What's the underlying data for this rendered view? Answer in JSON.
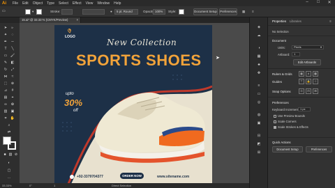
{
  "menubar": {
    "items": [
      "File",
      "Edit",
      "Object",
      "Type",
      "Select",
      "Effect",
      "View",
      "Window",
      "Help"
    ],
    "window_controls": [
      "–",
      "□",
      "✕"
    ]
  },
  "control_bar": {
    "stroke_label": "Stroke:",
    "brush_value": "5 pt. Round",
    "opacity_label": "Opacity:",
    "opacity_value": "100%",
    "style_label": "Style:",
    "doc_setup": "Document Setup",
    "preferences": "Preferences"
  },
  "document_tab": {
    "title": "15.ai* @ 33.33 % (CMYK/Preview)",
    "close": "×"
  },
  "artwork": {
    "logo_text": "LOGO",
    "script_heading": "New Collection",
    "headline": "SPORTS SHOES",
    "offer_small": "upto",
    "offer_percent": "30%",
    "offer_off": "off",
    "phone": "+92-3379704377",
    "order_button": "ORDER NOW",
    "website": "www.sitename.com",
    "colors": {
      "navy": "#1d3047",
      "orange": "#f2a33a",
      "cream": "#e8e1cf",
      "red": "#c0392b"
    }
  },
  "statusbar": {
    "zoom": "33.33%",
    "rotation": "0°",
    "page": "1",
    "tool_name": "Direct Selection"
  },
  "properties": {
    "tab_properties": "Properties",
    "tab_libraries": "Libraries",
    "no_selection": "No Selection",
    "document_heading": "Document",
    "units_label": "Units:",
    "units_value": "Pixels",
    "artboard_label": "Artboard:",
    "artboard_value": "1",
    "edit_artboards": "Edit Artboards",
    "rulers_grids": "Rulers & Grids",
    "guides": "Guides",
    "snap_options": "Snap Options",
    "preferences_heading": "Preferences",
    "keyboard_increment_label": "Keyboard Increment:",
    "keyboard_increment_value": "1 px",
    "use_preview_bounds": "Use Preview Bounds",
    "scale_corners": "Scale Corners",
    "scale_strokes": "Scale Strokes & Effects",
    "quick_actions": "Quick Actions",
    "document_setup": "Document Setup",
    "preferences": "Preferences"
  }
}
